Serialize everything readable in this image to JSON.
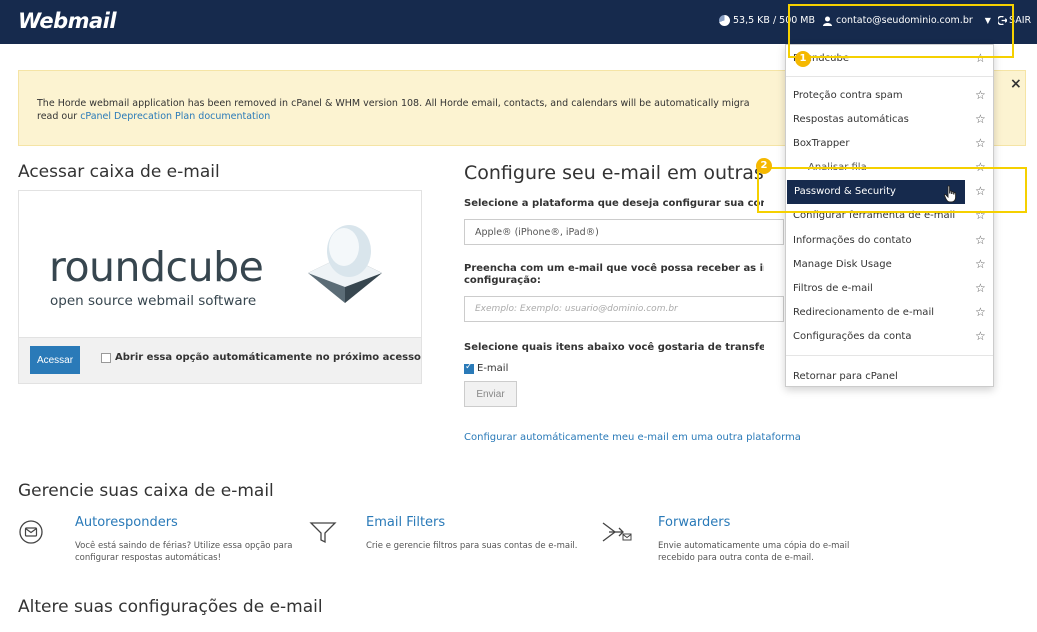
{
  "header": {
    "logo": "Webmail",
    "quota": "53,5 KB / 500 MB",
    "user": "contato@seudominio.com.br",
    "logout": "SAIR"
  },
  "annotations": {
    "step1": "1",
    "step2": "2"
  },
  "notice": {
    "text": "The Horde webmail application has been removed in cPanel & WHM version 108. All Horde email, contacts, and calendars will be automatically migra",
    "text_line2_prefix": "read our",
    "link": "cPanel Deprecation Plan documentation",
    "close": "×"
  },
  "access": {
    "title": "Acessar caixa de e-mail",
    "logo_text": "roundcube",
    "logo_sub": "open source webmail software",
    "button": "Acessar",
    "auto_open_label": "Abrir essa opção automáticamente no próximo acesso"
  },
  "configure": {
    "title": "Configure seu e-mail em outras p",
    "platform_label": "Selecione a plataforma que deseja configurar sua conta de",
    "platform_value": "Apple® (iPhone®, iPad®)",
    "email_label_line1": "Preencha com um e-mail que você possa receber as instruç",
    "email_label_line2": "configuração:",
    "email_placeholder": "Exemplo: Exemplo: usuario@dominio.com.br",
    "transfer_label": "Selecione quais itens abaixo você gostaria de transferir par",
    "email_check_label": "E-mail",
    "send_button": "Enviar",
    "auto_link": "Configurar automáticamente meu e-mail em uma outra plataforma"
  },
  "manage": {
    "title": "Gerencie suas caixa de e-mail",
    "tools": [
      {
        "title": "Autoresponders",
        "desc": "Você está saindo de férias? Utilize essa opção para configurar respostas automáticas!"
      },
      {
        "title": "Email Filters",
        "desc": "Crie e gerencie filtros para suas contas de e-mail."
      },
      {
        "title": "Forwarders",
        "desc": "Envie automaticamente uma cópia do e-mail recebido para outra conta de e-mail."
      }
    ]
  },
  "settings": {
    "title": "Altere suas configurações de e-mail"
  },
  "dropdown": {
    "items": [
      {
        "label": "Roundcube"
      },
      {
        "label": "Proteção contra spam"
      },
      {
        "label": "Respostas automáticas"
      },
      {
        "label": "BoxTrapper"
      },
      {
        "label": "Analisar fila"
      },
      {
        "label": "Password & Security"
      },
      {
        "label": "Configurar ferramenta de e-mail"
      },
      {
        "label": "Informações do contato"
      },
      {
        "label": "Manage Disk Usage"
      },
      {
        "label": "Filtros de e-mail"
      },
      {
        "label": "Redirecionamento de e-mail"
      },
      {
        "label": "Configurações da conta"
      },
      {
        "label": "Retornar para cPanel"
      }
    ],
    "star": "☆"
  },
  "colors": {
    "navbar": "#162a4d",
    "accent": "#2a7ab8",
    "highlight": "#f5d000",
    "notice_bg": "#fcf3d1"
  }
}
